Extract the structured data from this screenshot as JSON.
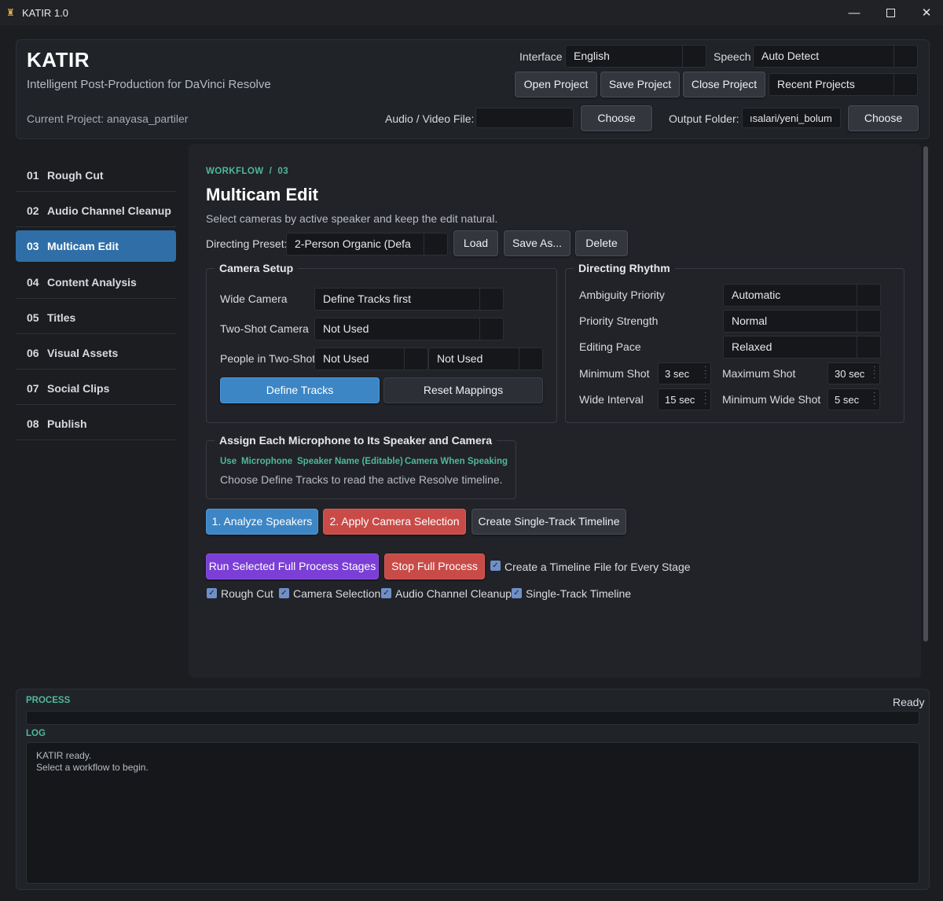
{
  "window": {
    "title": "KATIR 1.0",
    "icon": "katir-logo-icon"
  },
  "header": {
    "app_name": "KATIR",
    "subtitle": "Intelligent Post-Production for DaVinci Resolve",
    "current_project": "Current Project: anayasa_partiler",
    "interface_label": "Interface",
    "interface_value": "English",
    "speech_label": "Speech",
    "speech_value": "Auto Detect",
    "open_project": "Open Project",
    "save_project": "Save Project",
    "close_project": "Close Project",
    "recent_projects": "Recent Projects",
    "av_file_label": "Audio / Video File:",
    "av_file_value": "",
    "choose_av": "Choose",
    "output_label": "Output Folder:",
    "output_value": "ısalari/yeni_bolum",
    "choose_output": "Choose"
  },
  "sidebar": {
    "items": [
      {
        "num": "01",
        "label": "Rough Cut"
      },
      {
        "num": "02",
        "label": "Audio Channel Cleanup"
      },
      {
        "num": "03",
        "label": "Multicam Edit",
        "active": true
      },
      {
        "num": "04",
        "label": "Content Analysis"
      },
      {
        "num": "05",
        "label": "Titles"
      },
      {
        "num": "06",
        "label": "Visual Assets"
      },
      {
        "num": "07",
        "label": "Social Clips"
      },
      {
        "num": "08",
        "label": "Publish"
      }
    ]
  },
  "main": {
    "breadcrumb": "WORKFLOW  /  03",
    "title": "Multicam Edit",
    "description": "Select cameras by active speaker and keep the edit natural.",
    "preset_label": "Directing Preset:",
    "preset_value": "2-Person Organic (Defa",
    "load": "Load",
    "save_as": "Save As...",
    "delete": "Delete",
    "camera_setup": {
      "title": "Camera Setup",
      "wide_label": "Wide Camera",
      "wide_value": "Define Tracks first",
      "two_shot_label": "Two-Shot Camera",
      "two_shot_value": "Not Used",
      "people_label": "People in Two-Shot",
      "people_value_1": "Not Used",
      "people_value_2": "Not Used",
      "define_tracks": "Define Tracks",
      "reset_mappings": "Reset Mappings"
    },
    "directing_rhythm": {
      "title": "Directing Rhythm",
      "ambiguity_label": "Ambiguity Priority",
      "ambiguity_value": "Automatic",
      "strength_label": "Priority Strength",
      "strength_value": "Normal",
      "pace_label": "Editing Pace",
      "pace_value": "Relaxed",
      "min_shot_label": "Minimum Shot",
      "min_shot_value": "3 sec",
      "max_shot_label": "Maximum Shot",
      "max_shot_value": "30 sec",
      "wide_interval_label": "Wide Interval",
      "wide_interval_value": "15 sec",
      "min_wide_label": "Minimum Wide Shot",
      "min_wide_value": "5 sec"
    },
    "microphones": {
      "title": "Assign Each Microphone to Its Speaker and Camera",
      "col_use": "Use",
      "col_microphone": "Microphone",
      "col_speaker": "Speaker Name (Editable)",
      "col_camera": "Camera When Speaking",
      "hint": "Choose Define Tracks to read the active Resolve timeline."
    },
    "analyze": "1. Analyze Speakers",
    "apply_camera": "2. Apply Camera Selection",
    "create_single": "Create Single-Track Timeline",
    "run_full": "Run Selected Full Process Stages",
    "stop_full": "Stop Full Process",
    "timeline_file_check": "Create a Timeline File for Every Stage",
    "stages": [
      "Rough Cut",
      "Camera Selection",
      "Audio Channel Cleanup",
      "Single-Track Timeline"
    ]
  },
  "bottom": {
    "process_label": "PROCESS",
    "status": "Ready",
    "log_label": "LOG",
    "log_lines": [
      "KATIR ready.",
      "Select a workflow to begin."
    ]
  },
  "colors": {
    "accent_blue": "#3c86c6",
    "accent_red": "#c94b47",
    "accent_purple": "#7b3ed6",
    "accent_teal": "#4fb89a",
    "active_nav": "#2f6ea6"
  }
}
